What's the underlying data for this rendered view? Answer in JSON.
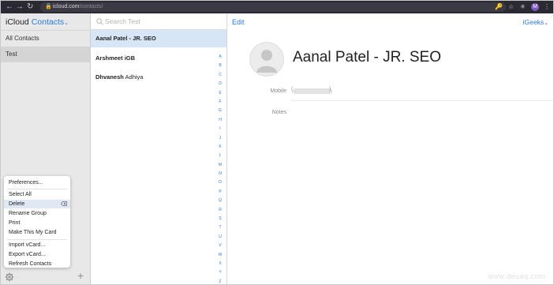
{
  "browser": {
    "url_host": "icloud.com",
    "url_path": "/contacts/",
    "profile_initial": "M"
  },
  "sidebar": {
    "brand_prefix": "iCloud",
    "brand_app": "Contacts",
    "groups": [
      {
        "label": "All Contacts"
      },
      {
        "label": "Test"
      }
    ]
  },
  "menu": {
    "items": [
      "Preferences...",
      "Select All",
      "Delete",
      "Rename Group",
      "Print",
      "Make This My Card",
      "Import vCard...",
      "Export vCard...",
      "Refresh Contacts"
    ]
  },
  "list": {
    "search_placeholder": "Search Test",
    "contacts": [
      {
        "first": "Aanal Patel - JR. SEO",
        "last": ""
      },
      {
        "first": "Arshmeet",
        "last": "iGB"
      },
      {
        "first": "Dhvanesh",
        "last": "Adhiya"
      }
    ],
    "index_letters": [
      "A",
      "B",
      "C",
      "D",
      "E",
      "F",
      "G",
      "H",
      "I",
      "J",
      "K",
      "L",
      "M",
      "N",
      "O",
      "P",
      "Q",
      "R",
      "S",
      "T",
      "U",
      "V",
      "W",
      "X",
      "Y",
      "Z",
      "#"
    ]
  },
  "detail": {
    "edit_label": "Edit",
    "account_label": "iGeeks",
    "name": "Aanal Patel - JR. SEO",
    "mobile_label": "Mobile",
    "notes_label": "Notes"
  },
  "watermark": "www.deuaq.com",
  "colors": {
    "accent": "#2a7ae2",
    "selection": "#d6e6f7",
    "chrome": "#2b2a33"
  }
}
